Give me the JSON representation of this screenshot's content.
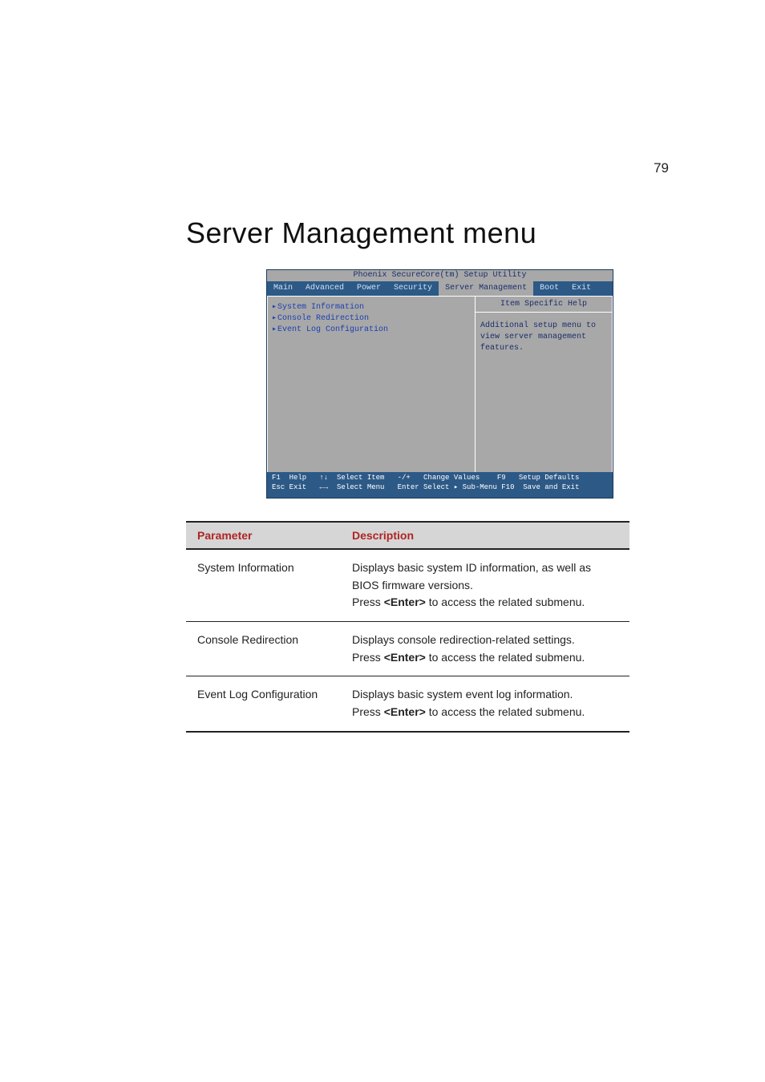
{
  "page_number": "79",
  "heading": "Server Management menu",
  "bios": {
    "title": "Phoenix SecureCore(tm) Setup Utility",
    "tabs": [
      "Main",
      "Advanced",
      "Power",
      "Security",
      "Server Management",
      "Boot",
      "Exit"
    ],
    "active_tab_index": 4,
    "menu_items": [
      "System Information",
      "Console Redirection",
      "Event Log Configuration"
    ],
    "help_title": "Item Specific Help",
    "help_text": "Additional setup menu to view server management features.",
    "footer": {
      "line1": "F1  Help   ↑↓  Select Item   -/+   Change Values    F9   Setup Defaults",
      "line2": "Esc Exit   ←→  Select Menu   Enter Select ▸ Sub-Menu F10  Save and Exit"
    }
  },
  "table": {
    "headers": {
      "param": "Parameter",
      "desc": "Description"
    },
    "rows": [
      {
        "param": "System Information",
        "desc_line1": "Displays basic system ID information, as well as BIOS firmware versions.",
        "desc_press": "Press ",
        "desc_key": "<Enter>",
        "desc_after": " to access the related submenu."
      },
      {
        "param": "Console Redirection",
        "desc_line1": "Displays console redirection-related settings.",
        "desc_press": "Press ",
        "desc_key": "<Enter>",
        "desc_after": " to access the related submenu."
      },
      {
        "param": "Event Log Configuration",
        "desc_line1": "Displays basic system event log information.",
        "desc_press": "Press ",
        "desc_key": "<Enter>",
        "desc_after": " to access the related submenu."
      }
    ]
  }
}
